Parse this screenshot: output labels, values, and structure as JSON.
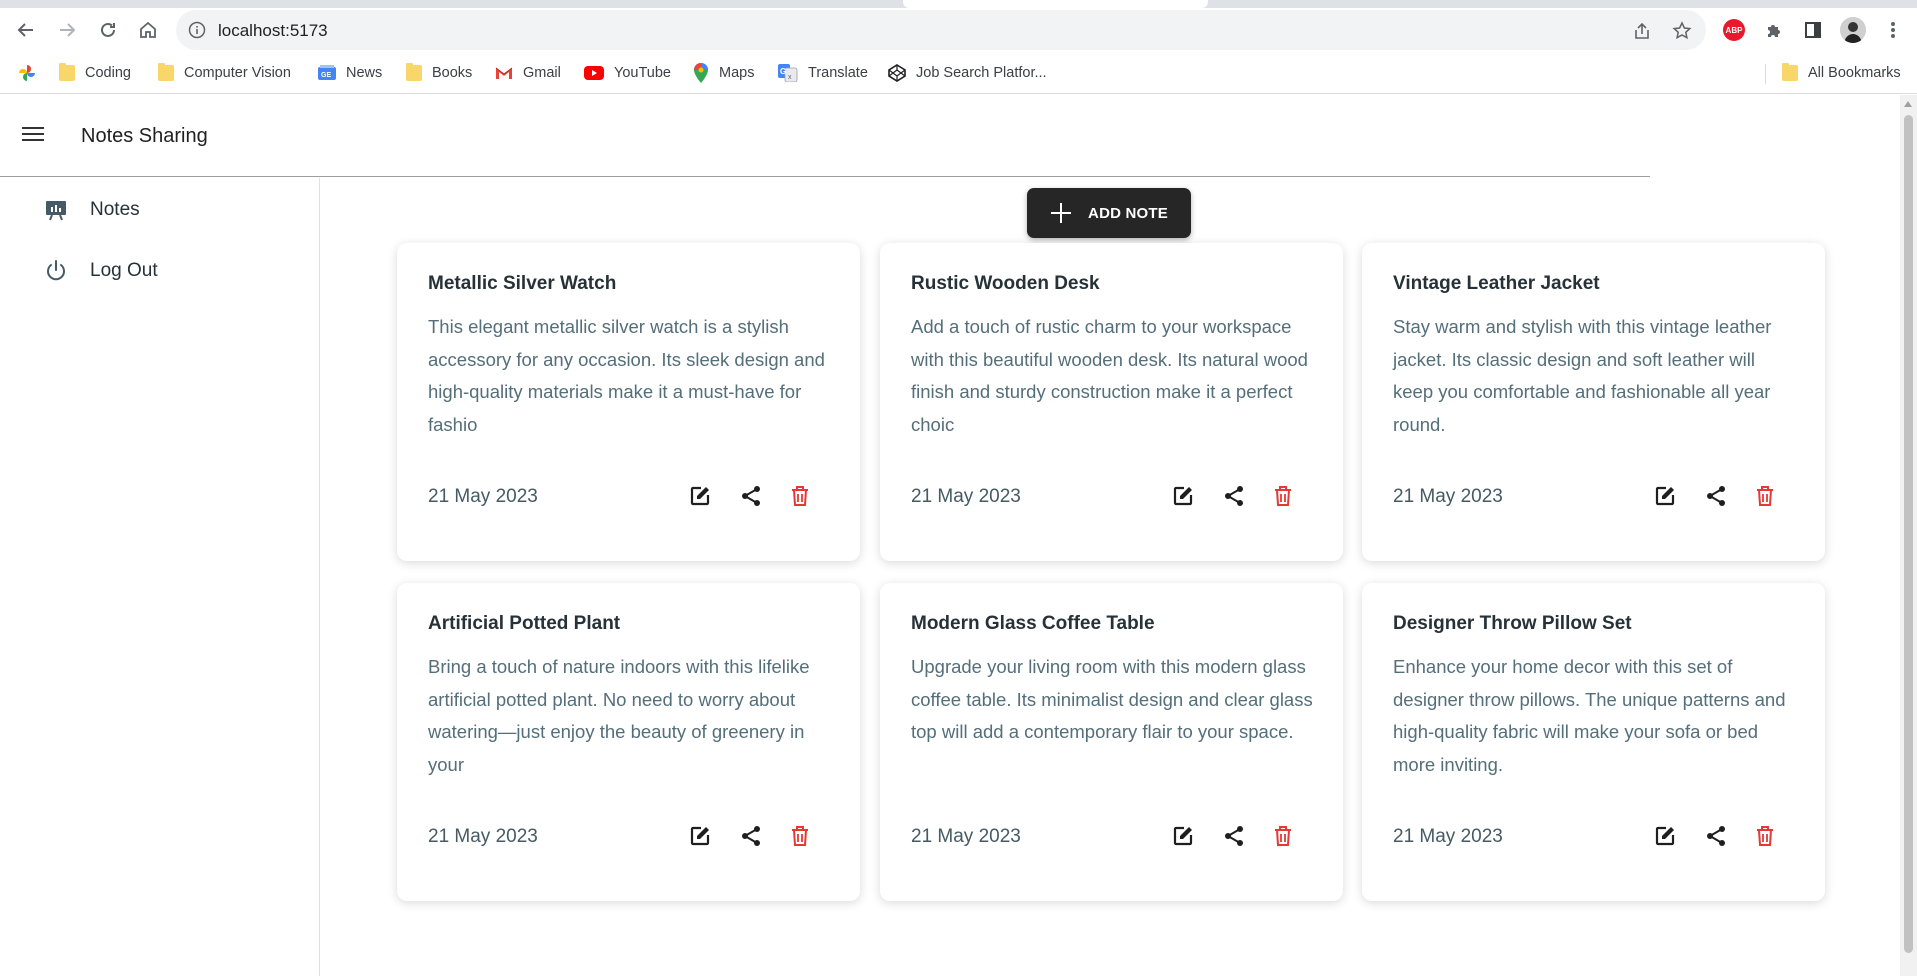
{
  "browser": {
    "url": "localhost:5173",
    "bookmarks": [
      {
        "label": "",
        "icon": "google-photos-icon"
      },
      {
        "label": "Coding",
        "icon": "folder-icon"
      },
      {
        "label": "Computer Vision",
        "icon": "folder-icon"
      },
      {
        "label": "News",
        "icon": "google-news-icon"
      },
      {
        "label": "Books",
        "icon": "folder-icon"
      },
      {
        "label": "Gmail",
        "icon": "gmail-icon"
      },
      {
        "label": "YouTube",
        "icon": "youtube-icon"
      },
      {
        "label": "Maps",
        "icon": "maps-icon"
      },
      {
        "label": "Translate",
        "icon": "translate-icon"
      },
      {
        "label": "Job Search Platfor...",
        "icon": "codepen-icon"
      }
    ],
    "all_bookmarks": "All Bookmarks",
    "abp_label": "ABP"
  },
  "app": {
    "title": "Notes Sharing",
    "sidebar": [
      {
        "label": "Notes",
        "icon": "notes-board-icon"
      },
      {
        "label": "Log Out",
        "icon": "power-icon"
      }
    ],
    "add_button": "ADD NOTE",
    "delete_color": "#e53935",
    "notes": [
      {
        "title": "Metallic Silver Watch",
        "description": "This elegant metallic silver watch is a stylish accessory for any occasion. Its sleek design and high-quality materials make it a must-have for fashio",
        "date": "21 May 2023"
      },
      {
        "title": "Rustic Wooden Desk",
        "description": "Add a touch of rustic charm to your workspace with this beautiful wooden desk. Its natural wood finish and sturdy construction make it a perfect choic",
        "date": "21 May 2023"
      },
      {
        "title": "Vintage Leather Jacket",
        "description": "Stay warm and stylish with this vintage leather jacket. Its classic design and soft leather will keep you comfortable and fashionable all year round.",
        "date": "21 May 2023"
      },
      {
        "title": "Artificial Potted Plant",
        "description": "Bring a touch of nature indoors with this lifelike artificial potted plant. No need to worry about watering—just enjoy the beauty of greenery in your",
        "date": "21 May 2023"
      },
      {
        "title": "Modern Glass Coffee Table",
        "description": "Upgrade your living room with this modern glass coffee table. Its minimalist design and clear glass top will add a contemporary flair to your space.",
        "date": "21 May 2023"
      },
      {
        "title": "Designer Throw Pillow Set",
        "description": "Enhance your home decor with this set of designer throw pillows. The unique patterns and high-quality fabric will make your sofa or bed more inviting.",
        "date": "21 May 2023"
      }
    ]
  }
}
